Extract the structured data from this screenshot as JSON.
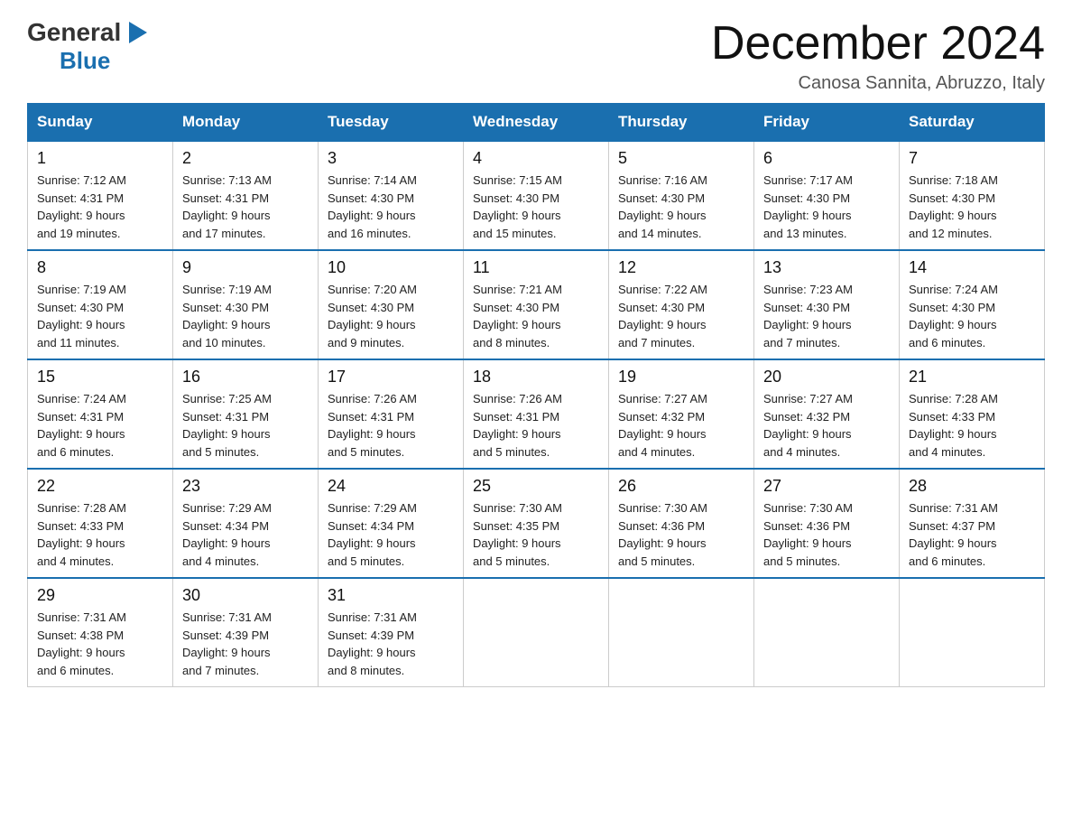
{
  "header": {
    "logo_general": "General",
    "logo_blue": "Blue",
    "month_title": "December 2024",
    "location": "Canosa Sannita, Abruzzo, Italy"
  },
  "weekdays": [
    "Sunday",
    "Monday",
    "Tuesday",
    "Wednesday",
    "Thursday",
    "Friday",
    "Saturday"
  ],
  "weeks": [
    [
      {
        "day": "1",
        "sunrise": "7:12 AM",
        "sunset": "4:31 PM",
        "daylight": "9 hours and 19 minutes."
      },
      {
        "day": "2",
        "sunrise": "7:13 AM",
        "sunset": "4:31 PM",
        "daylight": "9 hours and 17 minutes."
      },
      {
        "day": "3",
        "sunrise": "7:14 AM",
        "sunset": "4:30 PM",
        "daylight": "9 hours and 16 minutes."
      },
      {
        "day": "4",
        "sunrise": "7:15 AM",
        "sunset": "4:30 PM",
        "daylight": "9 hours and 15 minutes."
      },
      {
        "day": "5",
        "sunrise": "7:16 AM",
        "sunset": "4:30 PM",
        "daylight": "9 hours and 14 minutes."
      },
      {
        "day": "6",
        "sunrise": "7:17 AM",
        "sunset": "4:30 PM",
        "daylight": "9 hours and 13 minutes."
      },
      {
        "day": "7",
        "sunrise": "7:18 AM",
        "sunset": "4:30 PM",
        "daylight": "9 hours and 12 minutes."
      }
    ],
    [
      {
        "day": "8",
        "sunrise": "7:19 AM",
        "sunset": "4:30 PM",
        "daylight": "9 hours and 11 minutes."
      },
      {
        "day": "9",
        "sunrise": "7:19 AM",
        "sunset": "4:30 PM",
        "daylight": "9 hours and 10 minutes."
      },
      {
        "day": "10",
        "sunrise": "7:20 AM",
        "sunset": "4:30 PM",
        "daylight": "9 hours and 9 minutes."
      },
      {
        "day": "11",
        "sunrise": "7:21 AM",
        "sunset": "4:30 PM",
        "daylight": "9 hours and 8 minutes."
      },
      {
        "day": "12",
        "sunrise": "7:22 AM",
        "sunset": "4:30 PM",
        "daylight": "9 hours and 7 minutes."
      },
      {
        "day": "13",
        "sunrise": "7:23 AM",
        "sunset": "4:30 PM",
        "daylight": "9 hours and 7 minutes."
      },
      {
        "day": "14",
        "sunrise": "7:24 AM",
        "sunset": "4:30 PM",
        "daylight": "9 hours and 6 minutes."
      }
    ],
    [
      {
        "day": "15",
        "sunrise": "7:24 AM",
        "sunset": "4:31 PM",
        "daylight": "9 hours and 6 minutes."
      },
      {
        "day": "16",
        "sunrise": "7:25 AM",
        "sunset": "4:31 PM",
        "daylight": "9 hours and 5 minutes."
      },
      {
        "day": "17",
        "sunrise": "7:26 AM",
        "sunset": "4:31 PM",
        "daylight": "9 hours and 5 minutes."
      },
      {
        "day": "18",
        "sunrise": "7:26 AM",
        "sunset": "4:31 PM",
        "daylight": "9 hours and 5 minutes."
      },
      {
        "day": "19",
        "sunrise": "7:27 AM",
        "sunset": "4:32 PM",
        "daylight": "9 hours and 4 minutes."
      },
      {
        "day": "20",
        "sunrise": "7:27 AM",
        "sunset": "4:32 PM",
        "daylight": "9 hours and 4 minutes."
      },
      {
        "day": "21",
        "sunrise": "7:28 AM",
        "sunset": "4:33 PM",
        "daylight": "9 hours and 4 minutes."
      }
    ],
    [
      {
        "day": "22",
        "sunrise": "7:28 AM",
        "sunset": "4:33 PM",
        "daylight": "9 hours and 4 minutes."
      },
      {
        "day": "23",
        "sunrise": "7:29 AM",
        "sunset": "4:34 PM",
        "daylight": "9 hours and 4 minutes."
      },
      {
        "day": "24",
        "sunrise": "7:29 AM",
        "sunset": "4:34 PM",
        "daylight": "9 hours and 5 minutes."
      },
      {
        "day": "25",
        "sunrise": "7:30 AM",
        "sunset": "4:35 PM",
        "daylight": "9 hours and 5 minutes."
      },
      {
        "day": "26",
        "sunrise": "7:30 AM",
        "sunset": "4:36 PM",
        "daylight": "9 hours and 5 minutes."
      },
      {
        "day": "27",
        "sunrise": "7:30 AM",
        "sunset": "4:36 PM",
        "daylight": "9 hours and 5 minutes."
      },
      {
        "day": "28",
        "sunrise": "7:31 AM",
        "sunset": "4:37 PM",
        "daylight": "9 hours and 6 minutes."
      }
    ],
    [
      {
        "day": "29",
        "sunrise": "7:31 AM",
        "sunset": "4:38 PM",
        "daylight": "9 hours and 6 minutes."
      },
      {
        "day": "30",
        "sunrise": "7:31 AM",
        "sunset": "4:39 PM",
        "daylight": "9 hours and 7 minutes."
      },
      {
        "day": "31",
        "sunrise": "7:31 AM",
        "sunset": "4:39 PM",
        "daylight": "9 hours and 8 minutes."
      },
      null,
      null,
      null,
      null
    ]
  ],
  "labels": {
    "sunrise": "Sunrise:",
    "sunset": "Sunset:",
    "daylight": "Daylight:"
  }
}
